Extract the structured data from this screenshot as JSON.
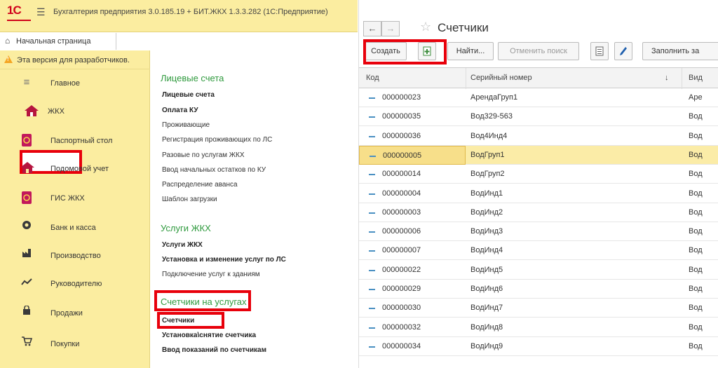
{
  "left_window": {
    "logo_text": "1С",
    "app_title": "Бухгалтерия предприятия 3.0.185.19 + БИТ.ЖКХ 1.3.3.282  (1С:Предприятие)",
    "home_tab": "Начальная страница",
    "warning_text": "Эта версия для разработчиков.",
    "nav": [
      {
        "label": "Главное",
        "icon": "menu-icon"
      },
      {
        "label": "ЖКХ",
        "icon": "house-icon",
        "active": true
      },
      {
        "label": "Паспортный стол",
        "icon": "passport-icon"
      },
      {
        "label": "Подомовой учет",
        "icon": "house-icon"
      },
      {
        "label": "ГИС ЖКХ",
        "icon": "passport-icon"
      },
      {
        "label": "Банк и касса",
        "icon": "coin-icon"
      },
      {
        "label": "Производство",
        "icon": "factory-icon"
      },
      {
        "label": "Руководителю",
        "icon": "chart-icon"
      },
      {
        "label": "Продажи",
        "icon": "bag-icon"
      },
      {
        "label": "Покупки",
        "icon": "cart-icon"
      }
    ],
    "groups": [
      {
        "title": "Лицевые счета",
        "links": [
          {
            "label": "Лицевые счета",
            "bold": true
          },
          {
            "label": "Оплата КУ",
            "bold": true
          },
          {
            "label": "Проживающие",
            "bold": false
          },
          {
            "label": "Регистрация проживающих по ЛС",
            "bold": false
          },
          {
            "label": "Разовые по услугам ЖКХ",
            "bold": false
          },
          {
            "label": "Ввод начальных остатков по КУ",
            "bold": false
          },
          {
            "label": "Распределение аванса",
            "bold": false
          },
          {
            "label": "Шаблон загрузки",
            "bold": false
          }
        ]
      },
      {
        "title": "Услуги ЖКХ",
        "links": [
          {
            "label": "Услуги ЖКХ",
            "bold": true
          },
          {
            "label": "Установка и изменение услуг по ЛС",
            "bold": true
          },
          {
            "label": "Подключение услуг к зданиям",
            "bold": false
          }
        ]
      },
      {
        "title": "Счетчики на услугах",
        "links": [
          {
            "label": "Счетчики",
            "bold": true
          },
          {
            "label": "Установка\\снятие счетчика",
            "bold": true
          },
          {
            "label": "Ввод показаний по счетчикам",
            "bold": true
          }
        ]
      }
    ]
  },
  "right_window": {
    "title": "Счетчики",
    "toolbar": {
      "create": "Создать",
      "find": "Найти...",
      "cancel_search": "Отменить поиск",
      "fill": "Заполнить за"
    },
    "columns": {
      "code": "Код",
      "serial": "Серийный номер",
      "type": "Вид"
    },
    "sort_arrow": "↓",
    "rows": [
      {
        "code": "000000023",
        "serial": "АрендаГруп1",
        "type": "Аре"
      },
      {
        "code": "000000035",
        "serial": "Вод329-563",
        "type": "Вод"
      },
      {
        "code": "000000036",
        "serial": "Вод4Инд4",
        "type": "Вод"
      },
      {
        "code": "000000005",
        "serial": "ВодГруп1",
        "type": "Вод",
        "selected": true
      },
      {
        "code": "000000014",
        "serial": "ВодГруп2",
        "type": "Вод"
      },
      {
        "code": "000000004",
        "serial": "ВодИнд1",
        "type": "Вод"
      },
      {
        "code": "000000003",
        "serial": "ВодИнд2",
        "type": "Вод"
      },
      {
        "code": "000000006",
        "serial": "ВодИнд3",
        "type": "Вод"
      },
      {
        "code": "000000007",
        "serial": "ВодИнд4",
        "type": "Вод"
      },
      {
        "code": "000000022",
        "serial": "ВодИнд5",
        "type": "Вод"
      },
      {
        "code": "000000029",
        "serial": "ВодИнд6",
        "type": "Вод"
      },
      {
        "code": "000000030",
        "serial": "ВодИнд7",
        "type": "Вод"
      },
      {
        "code": "000000032",
        "serial": "ВодИнд8",
        "type": "Вод"
      },
      {
        "code": "000000034",
        "serial": "ВодИнд9",
        "type": "Вод"
      }
    ]
  },
  "colors": {
    "accent_yellow": "#fbeda0",
    "group_green": "#2f9a3e",
    "highlight_red": "#e8000b",
    "selected_row": "#fbeca7"
  }
}
